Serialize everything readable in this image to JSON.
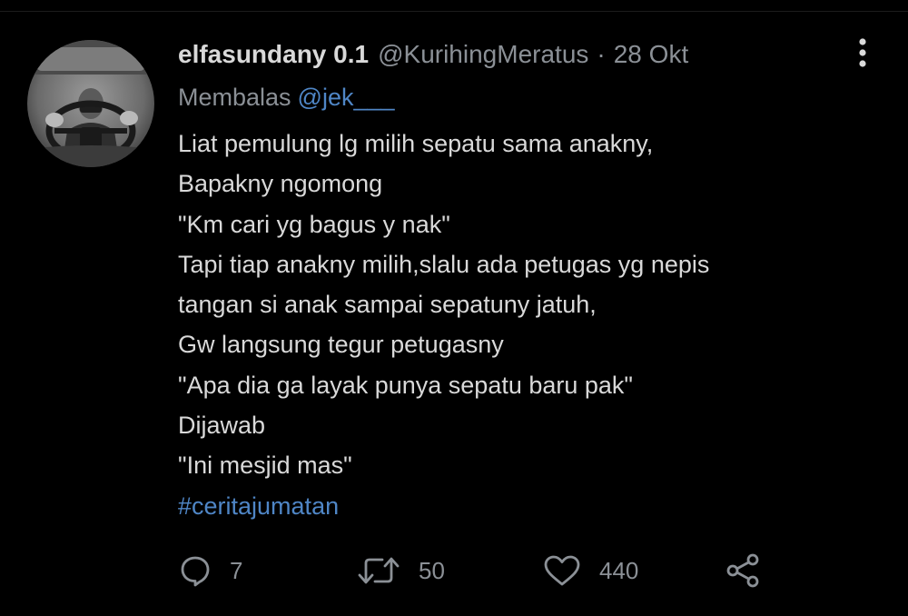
{
  "tweet": {
    "author": {
      "display_name": "elfasundany 0.1",
      "handle": "@KurihingMeratus",
      "separator": "·",
      "date": "28 Okt"
    },
    "reply": {
      "prefix": "Membalas",
      "mention": "@jek___"
    },
    "lines": [
      "Liat pemulung lg milih sepatu sama anakny,",
      "Bapakny ngomong",
      "\"Km cari yg bagus y nak\"",
      "Tapi tiap anakny milih,slalu ada petugas yg nepis",
      "tangan si anak sampai sepatuny jatuh,",
      "Gw langsung tegur petugasny",
      "\"Apa dia ga layak punya sepatu baru pak\"",
      "Dijawab",
      "\"Ini mesjid mas\""
    ],
    "hashtag": "#ceritajumatan",
    "actions": {
      "replies": "7",
      "retweets": "50",
      "likes": "440"
    }
  },
  "icons": {
    "more": "more-vertical-icon",
    "reply": "comment-icon",
    "retweet": "retweet-icon",
    "like": "heart-icon",
    "share": "share-icon"
  },
  "colors": {
    "background": "#000000",
    "text_primary": "#d9d9d9",
    "text_secondary": "#8b9096",
    "link": "#4f86c6"
  }
}
